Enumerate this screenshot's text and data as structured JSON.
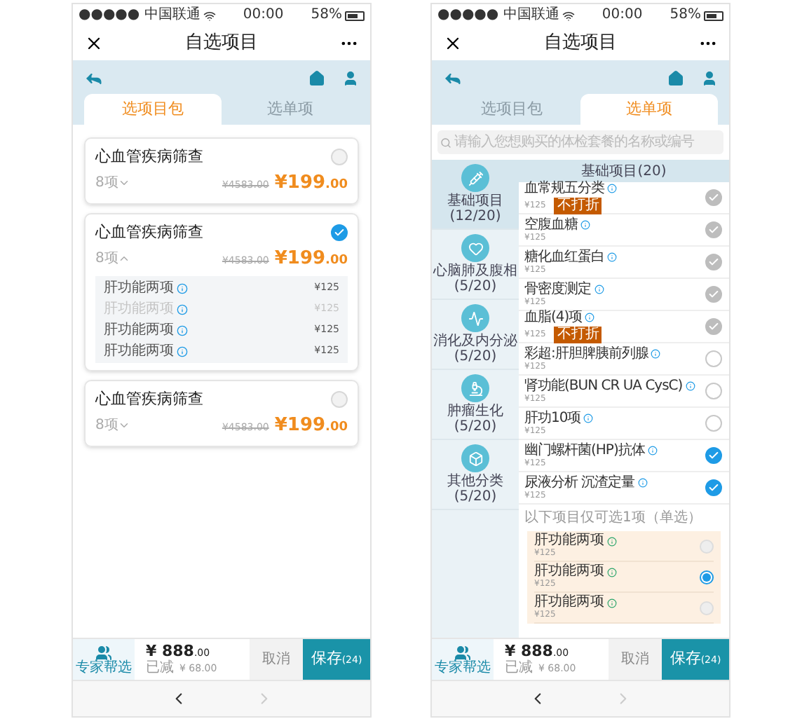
{
  "screens": [
    {
      "kind": "packages",
      "status_bar": {
        "carrier": "●●●●● 中国联通",
        "time": "00:00",
        "battery": "58%"
      },
      "title": "自选项目",
      "tabs": [
        {
          "label": "选项目包",
          "selected": true
        },
        {
          "label": "选单项",
          "selected": false
        }
      ],
      "packages": [
        {
          "name": "心血管疾病筛查",
          "count": "8项",
          "expanded": false,
          "selected": false,
          "original_price": "¥4583.00",
          "price": "¥199",
          "price_decimals": ".00"
        },
        {
          "name": "心血管疾病筛查",
          "count": "8项",
          "expanded": true,
          "selected": true,
          "original_price": "¥4583.00",
          "price": "¥199",
          "price_decimals": ".00",
          "items": [
            {
              "name": "肝功能两项",
              "price": "¥125",
              "removed": false
            },
            {
              "name": "肝功能两项",
              "price": "¥125",
              "removed": true
            },
            {
              "name": "肝功能两项",
              "price": "¥125",
              "removed": false
            },
            {
              "name": "肝功能两项",
              "price": "¥125",
              "removed": false
            }
          ]
        },
        {
          "name": "心血管疾病筛查",
          "count": "8项",
          "expanded": false,
          "selected": false,
          "original_price": "¥4583.00",
          "price": "¥199",
          "price_decimals": ".00"
        }
      ],
      "footer": {
        "expert_label": "专家帮选",
        "total": "¥ 888",
        "total_decimals": ".00",
        "saved_label": "已减",
        "saved": "¥ 68.00",
        "cancel": "取消",
        "save": "保存",
        "save_count": "(24)"
      },
      "forward_disabled": true
    },
    {
      "kind": "single_items",
      "status_bar": {
        "carrier": "●●●●● 中国联通",
        "time": "00:00",
        "battery": "58%"
      },
      "title": "自选项目",
      "tabs": [
        {
          "label": "选项目包",
          "selected": false
        },
        {
          "label": "选单项",
          "selected": true
        }
      ],
      "search": {
        "placeholder": "请输入您想购买的体检套餐的名称或编号"
      },
      "categories": [
        {
          "label": "基础项目(12/20)",
          "selected": true
        },
        {
          "label": "心脑肺及腹相(5/20)",
          "selected": false
        },
        {
          "label": "消化及内分泌(5/20)",
          "selected": false
        },
        {
          "label": "肿瘤生化(5/20)",
          "selected": false
        },
        {
          "label": "其他分类(5/20)",
          "selected": false
        }
      ],
      "section_title": "基础项目(20)",
      "items": [
        {
          "name": "血常规五分类",
          "price": "¥125",
          "tag": "不打折",
          "checked": true,
          "disabled": true
        },
        {
          "name": "空腹血糖",
          "price": "¥125",
          "checked": true,
          "disabled": true
        },
        {
          "name": "糖化血红蛋白",
          "price": "¥125",
          "checked": true,
          "disabled": true
        },
        {
          "name": "骨密度测定",
          "price": "¥125",
          "checked": true,
          "disabled": true
        },
        {
          "name": "血脂(4)项",
          "price": "¥125",
          "tag": "不打折",
          "checked": true,
          "disabled": true
        },
        {
          "name": "彩超:肝胆脾胰前列腺",
          "price": "¥125",
          "checked": false,
          "disabled": false
        },
        {
          "name": "肾功能(BUN CR UA CysC)",
          "price": "¥125",
          "checked": false,
          "disabled": false
        },
        {
          "name": "肝功10项",
          "price": "¥125",
          "checked": false,
          "disabled": false
        },
        {
          "name": "幽门螺杆菌(HP)抗体",
          "price": "¥125",
          "checked": true,
          "disabled": false
        },
        {
          "name": "尿液分析 沉渣定量",
          "price": "¥125",
          "checked": true,
          "disabled": false
        }
      ],
      "choice_title": "以下项目仅可选1项（单选）",
      "choices": [
        {
          "name": "肝功能两项",
          "price": "¥125",
          "selected": false
        },
        {
          "name": "肝功能两项",
          "price": "¥125",
          "selected": true
        },
        {
          "name": "肝功能两项",
          "price": "¥125",
          "selected": false
        }
      ],
      "footer": {
        "expert_label": "专家帮选",
        "total": "¥ 888",
        "total_decimals": ".00",
        "saved_label": "已减",
        "saved": "¥ 68.00",
        "cancel": "取消",
        "save": "保存",
        "save_count": "(24)"
      },
      "forward_disabled": true
    }
  ]
}
